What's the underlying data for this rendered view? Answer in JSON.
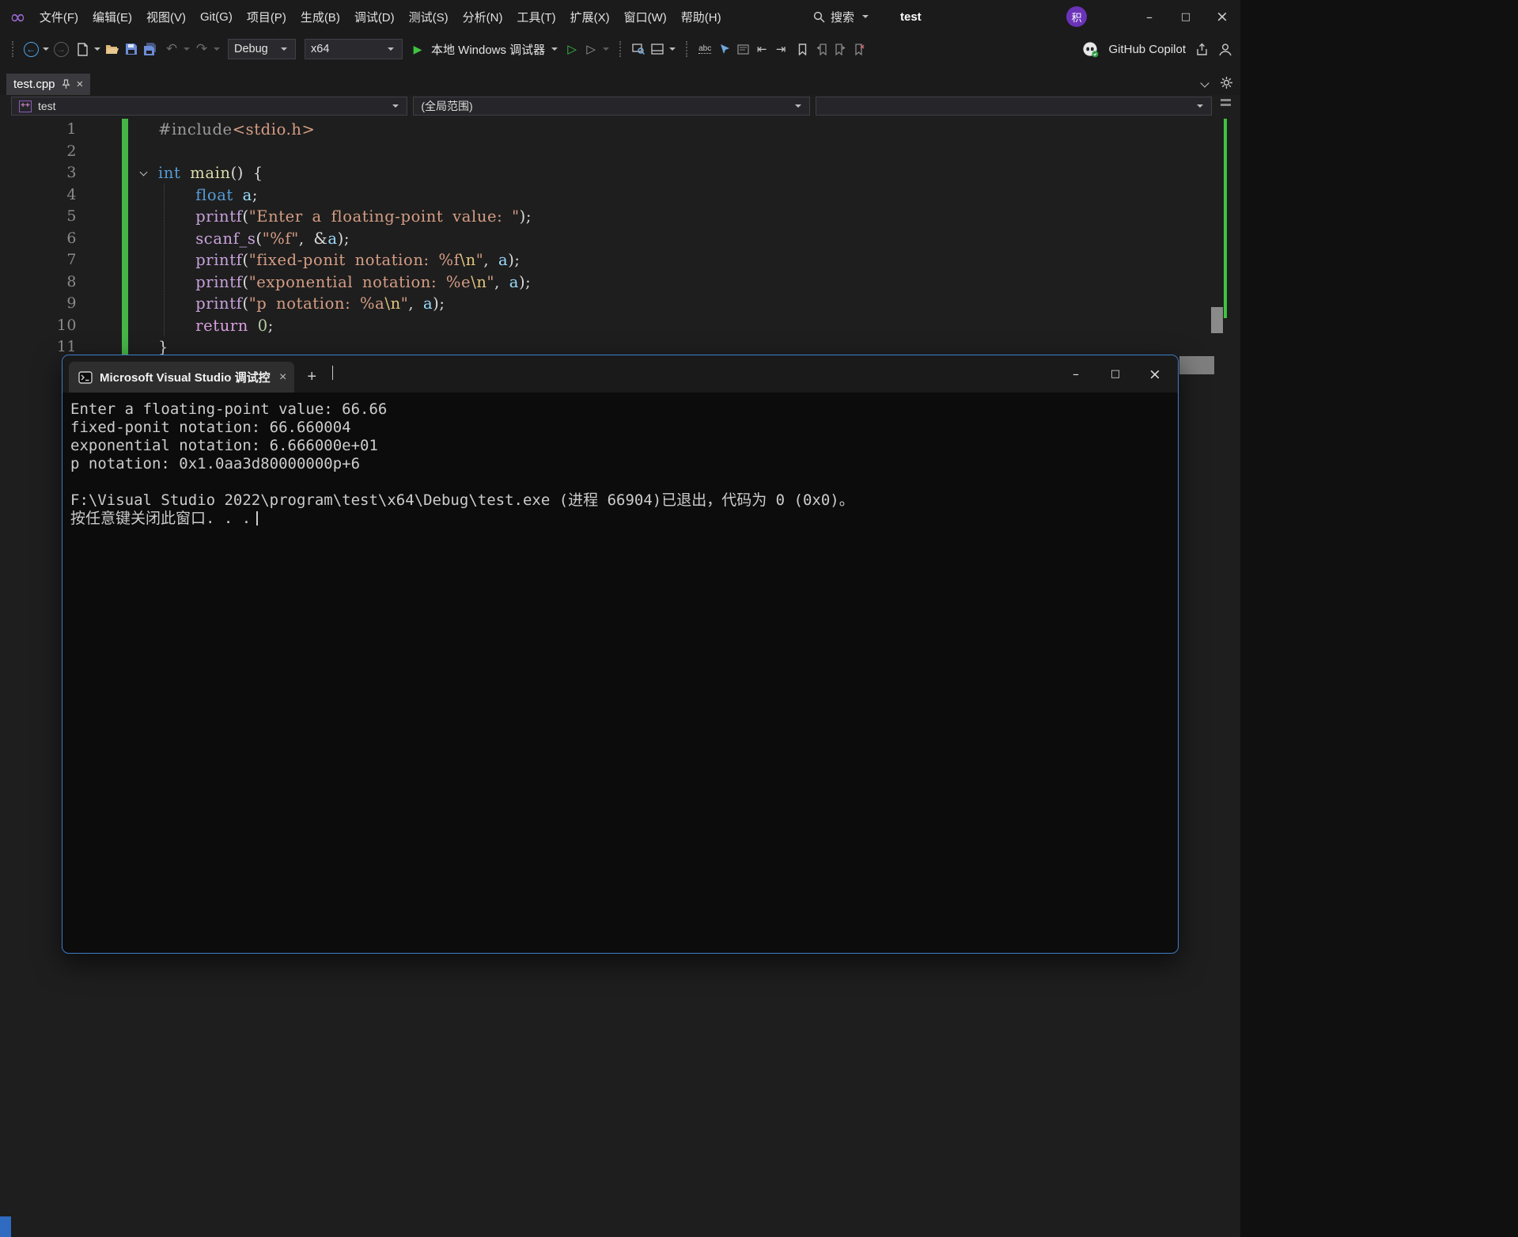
{
  "colors": {
    "accent_border_blue": "#3d7ec9",
    "modified_green": "#45b545",
    "keyword_blue": "#569cd6",
    "string_orange": "#d69d85",
    "run_green": "#3ec43e"
  },
  "window": {
    "titlebar": {
      "menu": [
        "文件(F)",
        "编辑(E)",
        "视图(V)",
        "Git(G)",
        "项目(P)",
        "生成(B)",
        "调试(D)",
        "测试(S)",
        "分析(N)",
        "工具(T)",
        "扩展(X)",
        "窗口(W)",
        "帮助(H)"
      ],
      "search_label": "搜索",
      "solution_name": "test",
      "account_badge": "积"
    },
    "toolbar": {
      "configuration": "Debug",
      "platform": "x64",
      "debug_target": "本地 Windows 调试器",
      "copilot_label": "GitHub Copilot"
    },
    "tab_strip": {
      "active_tab": "test.cpp"
    },
    "navbar": {
      "project_scope": "test",
      "member_scope": "(全局范围)"
    }
  },
  "editor": {
    "lines": [
      {
        "num": "1",
        "tokens": [
          {
            "c": "pp",
            "t": "#include"
          },
          {
            "c": "str",
            "t": "<stdio.h>"
          }
        ]
      },
      {
        "num": "2",
        "tokens": []
      },
      {
        "num": "3",
        "collapse": true,
        "tokens": [
          {
            "c": "kw",
            "t": "int"
          },
          {
            "c": "pl",
            "t": " "
          },
          {
            "c": "fn2",
            "t": "main"
          },
          {
            "c": "pl",
            "t": "() {"
          }
        ]
      },
      {
        "num": "4",
        "tokens": [
          {
            "c": "pl",
            "t": "    "
          },
          {
            "c": "kw",
            "t": "float"
          },
          {
            "c": "pl",
            "t": " "
          },
          {
            "c": "id",
            "t": "a"
          },
          {
            "c": "pl",
            "t": ";"
          }
        ]
      },
      {
        "num": "5",
        "tokens": [
          {
            "c": "pl",
            "t": "    "
          },
          {
            "c": "fn",
            "t": "printf"
          },
          {
            "c": "pl",
            "t": "("
          },
          {
            "c": "str",
            "t": "\"Enter a floating-point value: \""
          },
          {
            "c": "pl",
            "t": ");"
          }
        ]
      },
      {
        "num": "6",
        "tokens": [
          {
            "c": "pl",
            "t": "    "
          },
          {
            "c": "fn",
            "t": "scanf_s"
          },
          {
            "c": "pl",
            "t": "("
          },
          {
            "c": "str",
            "t": "\"%f\""
          },
          {
            "c": "pl",
            "t": ", &"
          },
          {
            "c": "id",
            "t": "a"
          },
          {
            "c": "pl",
            "t": ");"
          }
        ]
      },
      {
        "num": "7",
        "tokens": [
          {
            "c": "pl",
            "t": "    "
          },
          {
            "c": "fn",
            "t": "printf"
          },
          {
            "c": "pl",
            "t": "("
          },
          {
            "c": "str",
            "t": "\"fixed-ponit notation: %f"
          },
          {
            "c": "esc",
            "t": "\\n"
          },
          {
            "c": "str",
            "t": "\""
          },
          {
            "c": "pl",
            "t": ", "
          },
          {
            "c": "id",
            "t": "a"
          },
          {
            "c": "pl",
            "t": ");"
          }
        ]
      },
      {
        "num": "8",
        "tokens": [
          {
            "c": "pl",
            "t": "    "
          },
          {
            "c": "fn",
            "t": "printf"
          },
          {
            "c": "pl",
            "t": "("
          },
          {
            "c": "str",
            "t": "\"exponential notation: %e"
          },
          {
            "c": "esc",
            "t": "\\n"
          },
          {
            "c": "str",
            "t": "\""
          },
          {
            "c": "pl",
            "t": ", "
          },
          {
            "c": "id",
            "t": "a"
          },
          {
            "c": "pl",
            "t": ");"
          }
        ]
      },
      {
        "num": "9",
        "tokens": [
          {
            "c": "pl",
            "t": "    "
          },
          {
            "c": "fn",
            "t": "printf"
          },
          {
            "c": "pl",
            "t": "("
          },
          {
            "c": "str",
            "t": "\"p notation: %a"
          },
          {
            "c": "esc",
            "t": "\\n"
          },
          {
            "c": "str",
            "t": "\""
          },
          {
            "c": "pl",
            "t": ", "
          },
          {
            "c": "id",
            "t": "a"
          },
          {
            "c": "pl",
            "t": ");"
          }
        ]
      },
      {
        "num": "10",
        "tokens": [
          {
            "c": "pl",
            "t": "    "
          },
          {
            "c": "kc",
            "t": "return"
          },
          {
            "c": "pl",
            "t": " "
          },
          {
            "c": "num",
            "t": "0"
          },
          {
            "c": "pl",
            "t": ";"
          }
        ]
      },
      {
        "num": "11",
        "tokens": [
          {
            "c": "pl",
            "t": "}"
          }
        ]
      }
    ]
  },
  "console": {
    "tab_title": "Microsoft Visual Studio 调试控制台",
    "lines": [
      "Enter a floating-point value: 66.66",
      "fixed-ponit notation: 66.660004",
      "exponential notation: 6.666000e+01",
      "p notation: 0x1.0aa3d80000000p+6",
      "",
      "F:\\Visual Studio 2022\\program\\test\\x64\\Debug\\test.exe (进程 66904)已退出，代码为 0 (0x0)。",
      "按任意键关闭此窗口. . ."
    ]
  }
}
